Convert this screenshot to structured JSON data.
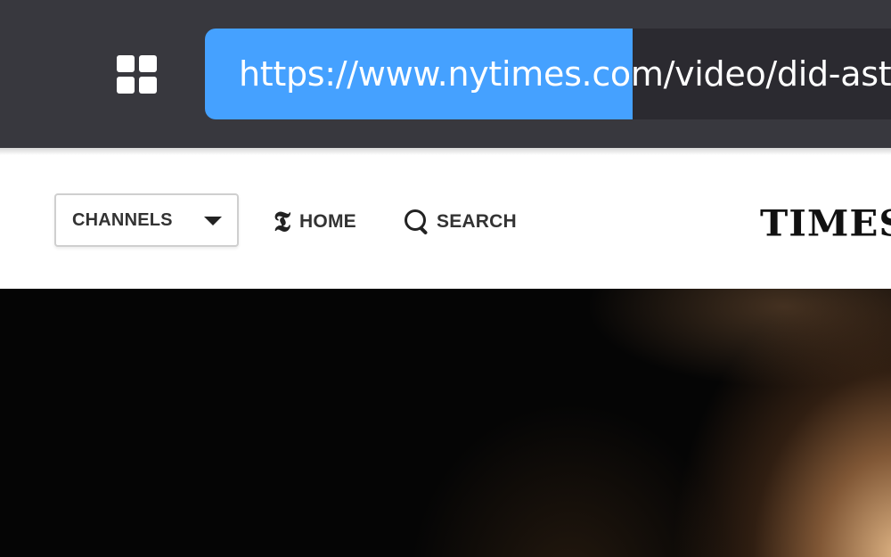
{
  "browser": {
    "url": "https://www.nytimes.com/video/did-aste",
    "apps_icon": "grid-apps-icon"
  },
  "header": {
    "channels_label": "CHANNELS",
    "home_label": "HOME",
    "search_label": "SEARCH",
    "logo_text": "TIMES",
    "home_icon": "nyt-t-logo-icon",
    "search_icon": "magnifier-icon"
  },
  "colors": {
    "browser_bar": "#38383e",
    "url_highlight": "#45a1ff",
    "url_field": "#2b2a30"
  }
}
